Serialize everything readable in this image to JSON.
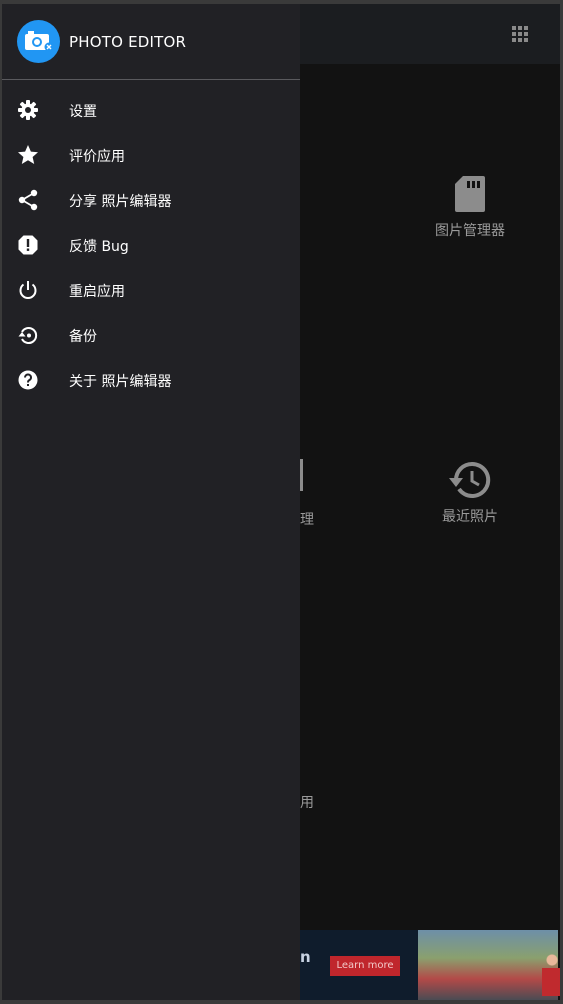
{
  "app": {
    "title": "PHOTO EDITOR",
    "logo_icon": "camera-icon",
    "accent": "#2196f3"
  },
  "drawer": {
    "items": [
      {
        "label": "设置",
        "icon": "gear-icon"
      },
      {
        "label": "评价应用",
        "icon": "star-icon"
      },
      {
        "label": "分享 照片编辑器",
        "icon": "share-icon"
      },
      {
        "label": "反馈 Bug",
        "icon": "alert-icon"
      },
      {
        "label": "重启应用",
        "icon": "power-icon"
      },
      {
        "label": "备份",
        "icon": "restore-icon"
      },
      {
        "label": "关于 照片编辑器",
        "icon": "help-icon"
      }
    ]
  },
  "background": {
    "apps_icon": "grid-icon",
    "tiles": [
      {
        "label": "图片管理器",
        "icon": "sd-card-icon"
      },
      {
        "label": "最近照片",
        "icon": "history-icon"
      }
    ],
    "partial_labels": [
      "理",
      "用"
    ]
  },
  "ad": {
    "text": "n",
    "button": "Learn more",
    "button_color": "#c0262c"
  }
}
